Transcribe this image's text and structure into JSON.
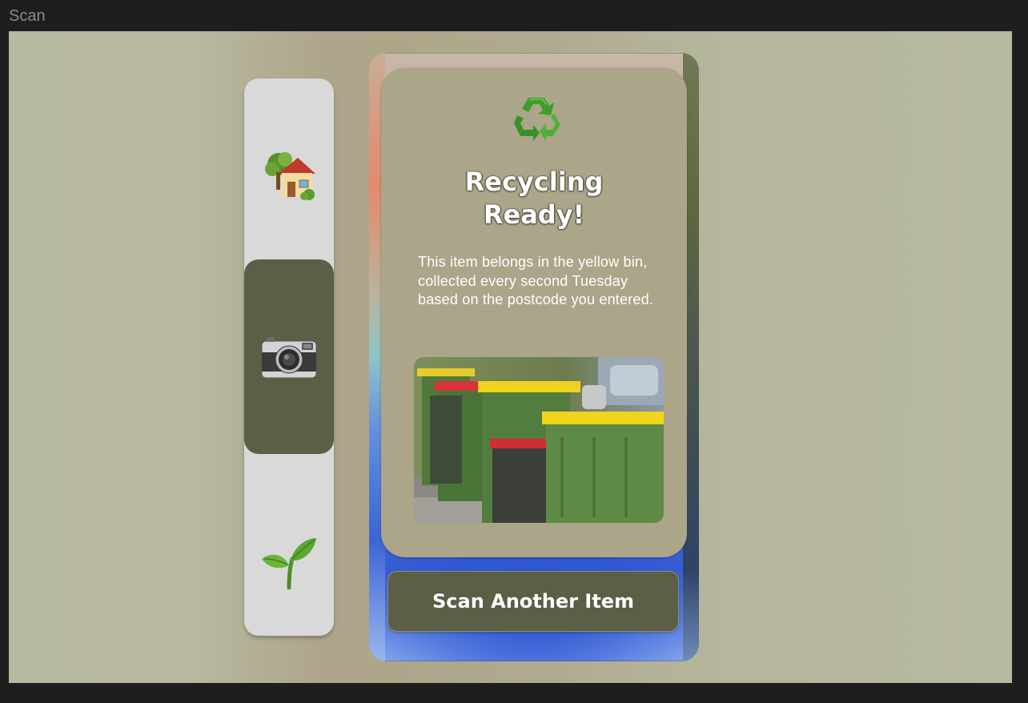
{
  "window": {
    "title": "Scan"
  },
  "nav": {
    "items": [
      {
        "icon": "house-with-garden-icon",
        "active": false
      },
      {
        "icon": "camera-icon",
        "active": true
      },
      {
        "icon": "seedling-icon",
        "active": false
      }
    ],
    "active_color": "#5a5f45",
    "background_color": "#d9d9d9"
  },
  "result": {
    "icon": "recycle-icon",
    "title_line1": "Recycling",
    "title_line2": "Ready!",
    "description": "This item belongs in the yellow bin, collected every second Tuesday based on the postcode you entered.",
    "image": "wheelie-bins-photo"
  },
  "action": {
    "scan_label": "Scan Another Item"
  },
  "colors": {
    "card": "#aba589",
    "button": "#5a5f45",
    "canvas": "#b7b9a0"
  }
}
